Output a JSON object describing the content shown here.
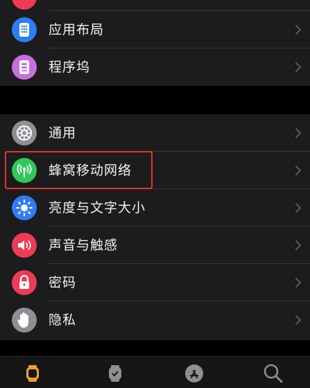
{
  "colors": {
    "background": "#000000",
    "group_background": "#1c1c1e",
    "separator": "#38383a",
    "highlight_box": "#e8352a",
    "tab_active": "#f0a02a",
    "tab_inactive": "#8e8e93"
  },
  "settings": {
    "group1": [
      {
        "label": "应用布局",
        "icon": "app-layout-grid-icon",
        "icon_color": "#2f7cf6"
      },
      {
        "label": "程序坞",
        "icon": "dock-icon",
        "icon_color": "#c86fe0"
      }
    ],
    "group2": [
      {
        "label": "通用",
        "icon": "gear-icon",
        "icon_color": "#8e8e93"
      },
      {
        "label": "蜂窝移动网络",
        "icon": "cellular-antenna-icon",
        "icon_color": "#30c85a"
      },
      {
        "label": "亮度与文字大小",
        "icon": "brightness-sun-icon",
        "icon_color": "#2f7cf6"
      },
      {
        "label": "声音与触感",
        "icon": "speaker-icon",
        "icon_color": "#ee3a54"
      },
      {
        "label": "密码",
        "icon": "lock-icon",
        "icon_color": "#ee3a54"
      },
      {
        "label": "隐私",
        "icon": "hand-icon",
        "icon_color": "#8e8e93"
      }
    ]
  },
  "tabbar": [
    {
      "icon": "my-watch-icon",
      "active": true
    },
    {
      "icon": "watch-face-gallery-icon",
      "active": false
    },
    {
      "icon": "app-store-icon",
      "active": false
    },
    {
      "icon": "search-icon",
      "active": false
    }
  ]
}
